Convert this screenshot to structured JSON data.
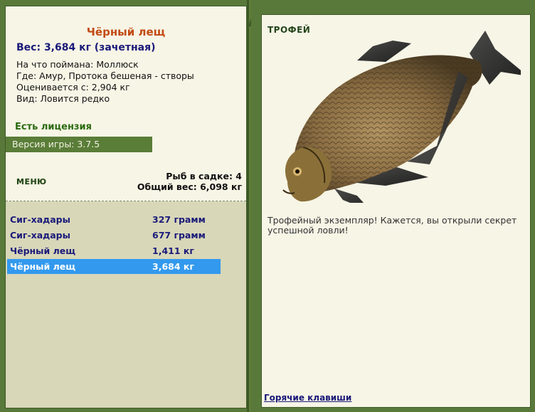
{
  "fish": {
    "name": "Чёрный лещ",
    "weight_line": "Вес: 3,684 кг (зачетная)",
    "caught_on": "На что поймана: Моллюск",
    "where": "Где: Амур, Протока бешеная - створы",
    "valued_from": "Оценивается с: 2,904 кг",
    "kind": "Вид: Ловится редко"
  },
  "license": "Есть лицензия",
  "version": "Версия игры: 3.7.5",
  "menu_label": "МЕНЮ",
  "cage": {
    "count_line": "Рыб в садке: 4",
    "total_line": "Общий вес: 6,098 кг"
  },
  "catches": [
    {
      "name": "Сиг-хадары",
      "weight": "327 грамм"
    },
    {
      "name": "Сиг-хадары",
      "weight": "677 грамм"
    },
    {
      "name": "Чёрный лещ",
      "weight": "1,411 кг"
    },
    {
      "name": "Чёрный лещ",
      "weight": "3,684 кг"
    }
  ],
  "selected_catch_index": 3,
  "trophy": {
    "label": "ТРОФЕЙ",
    "text": "Трофейный экземпляр! Кажется, вы открыли секрет успешной ловли!"
  },
  "hotkeys": "Горячие клавиши",
  "colors": {
    "frame_green": "#58793a",
    "panel_bg": "#f7f5e6",
    "title_orange": "#c24a12",
    "text_navy": "#1a1a7a",
    "selected_row": "#3399ee"
  },
  "icons": [
    "bream-fish-image",
    "corner-leaf-icon"
  ]
}
